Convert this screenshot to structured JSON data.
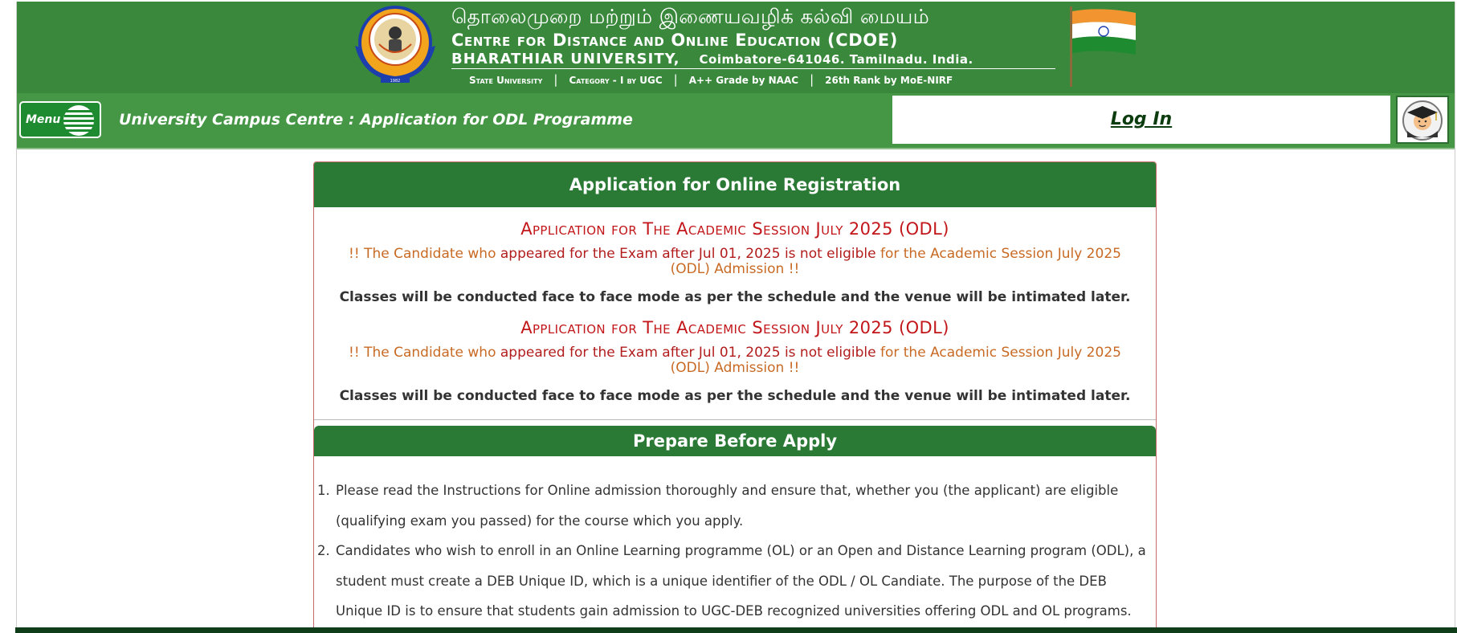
{
  "header": {
    "tamil_title": "தொலைமுறை மற்றும் இணையவழிக் கல்வி மையம்",
    "centre_name": "Centre for Distance and Online Education (CDOE)",
    "university_name": "BHARATHIAR UNIVERSITY,",
    "university_address": "Coimbatore-641046. Tamilnadu. India.",
    "credentials": [
      "State University",
      "Category - I by UGC",
      "A++ Grade by NAAC",
      "26th Rank by MoE-NIRF"
    ]
  },
  "navbar": {
    "menu_label": "Menu",
    "page_title": "University Campus Centre : Application for ODL Programme",
    "login_label": "Log In"
  },
  "registration": {
    "heading": "Application for Online Registration",
    "sessions": [
      {
        "title": "Application for The Academic Session July 2025 (ODL)",
        "notice_part1": "!! The Candidate who ",
        "notice_part2": "appeared for the Exam after Jul 01, 2025 is not eligible",
        "notice_part3": " for the Academic Session July 2025 (ODL) Admission !!",
        "classes_note": "Classes will be conducted face to face mode as per the schedule and the venue will be intimated later."
      },
      {
        "title": "Application for The Academic Session July 2025 (ODL)",
        "notice_part1": "!! The Candidate who ",
        "notice_part2": "appeared for the Exam after Jul 01, 2025 is not eligible",
        "notice_part3": " for the Academic Session July 2025 (ODL) Admission !!",
        "classes_note": "Classes will be conducted face to face mode as per the schedule and the venue will be intimated later."
      }
    ]
  },
  "prepare": {
    "heading": "Prepare Before Apply",
    "instructions": [
      "Please read the Instructions for Online admission thoroughly and ensure that, whether you (the applicant) are eligible (qualifying exam you passed) for the course which you apply.",
      "Candidates who wish to enroll in an Online Learning programme (OL) or an Open and Distance Learning program (ODL), a student must create a DEB Unique ID, which is a unique identifier of the ODL / OL Candiate. The purpose of the DEB Unique ID is to ensure that students gain admission to UGC-DEB recognized universities offering ODL and OL programs."
    ]
  },
  "colors": {
    "banner_green": "#39883c",
    "navbar_green": "#459745",
    "panel_header_green": "#2a7a35",
    "session_title_red": "#c2161a",
    "notice_orange": "#c86a24"
  },
  "icons": {
    "emblem": "university-emblem-icon",
    "flag": "indian-flag-icon",
    "menu": "menu-lines-icon",
    "avatar": "graduate-avatar-icon"
  }
}
